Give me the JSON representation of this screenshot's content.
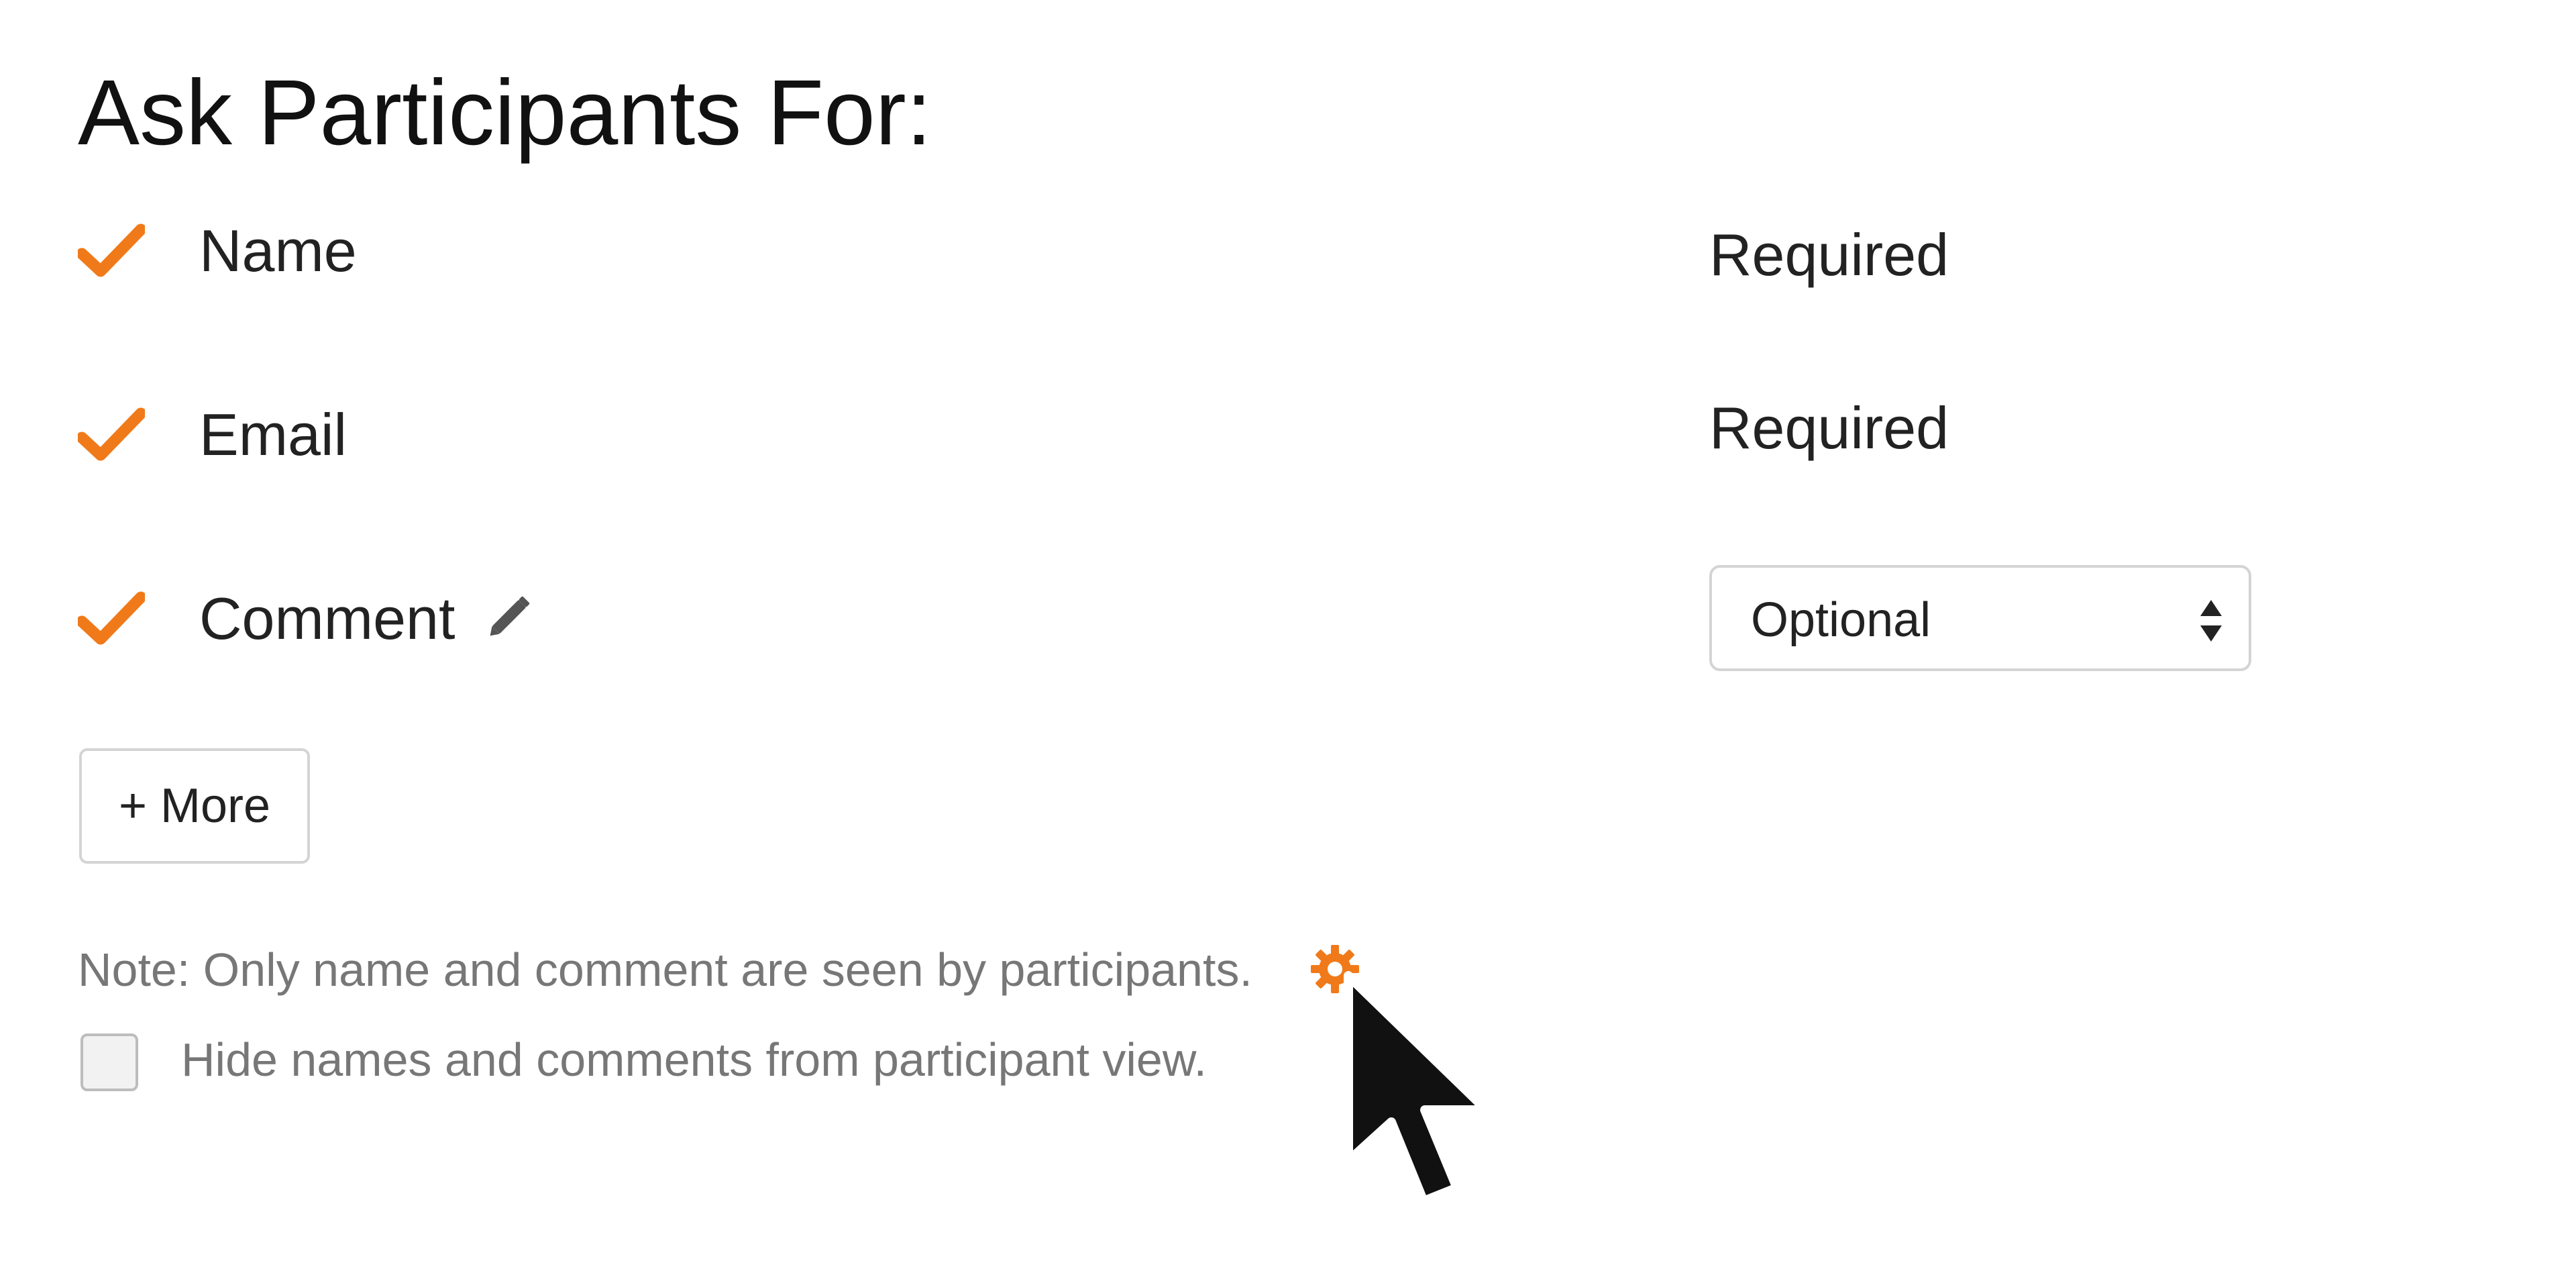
{
  "title": "Ask Participants For:",
  "fields": [
    {
      "label": "Name",
      "requirement": "Required"
    },
    {
      "label": "Email",
      "requirement": "Required"
    },
    {
      "label": "Comment",
      "requirement_select": "Optional"
    }
  ],
  "more_button_label": "+ More",
  "note": "Note: Only name and comment are seen by participants.",
  "hide_checkbox_label": "Hide names and comments from participant view.",
  "hide_checkbox_checked": false,
  "colors": {
    "accent": "#f07a1a",
    "text": "#222222",
    "muted_text": "#777777",
    "border": "#d4d4d4"
  },
  "icons": {
    "check": "check-icon",
    "edit": "pencil-icon",
    "settings": "gear-icon",
    "select_arrows": "select-arrows-icon",
    "pointer": "mouse-pointer-icon"
  }
}
